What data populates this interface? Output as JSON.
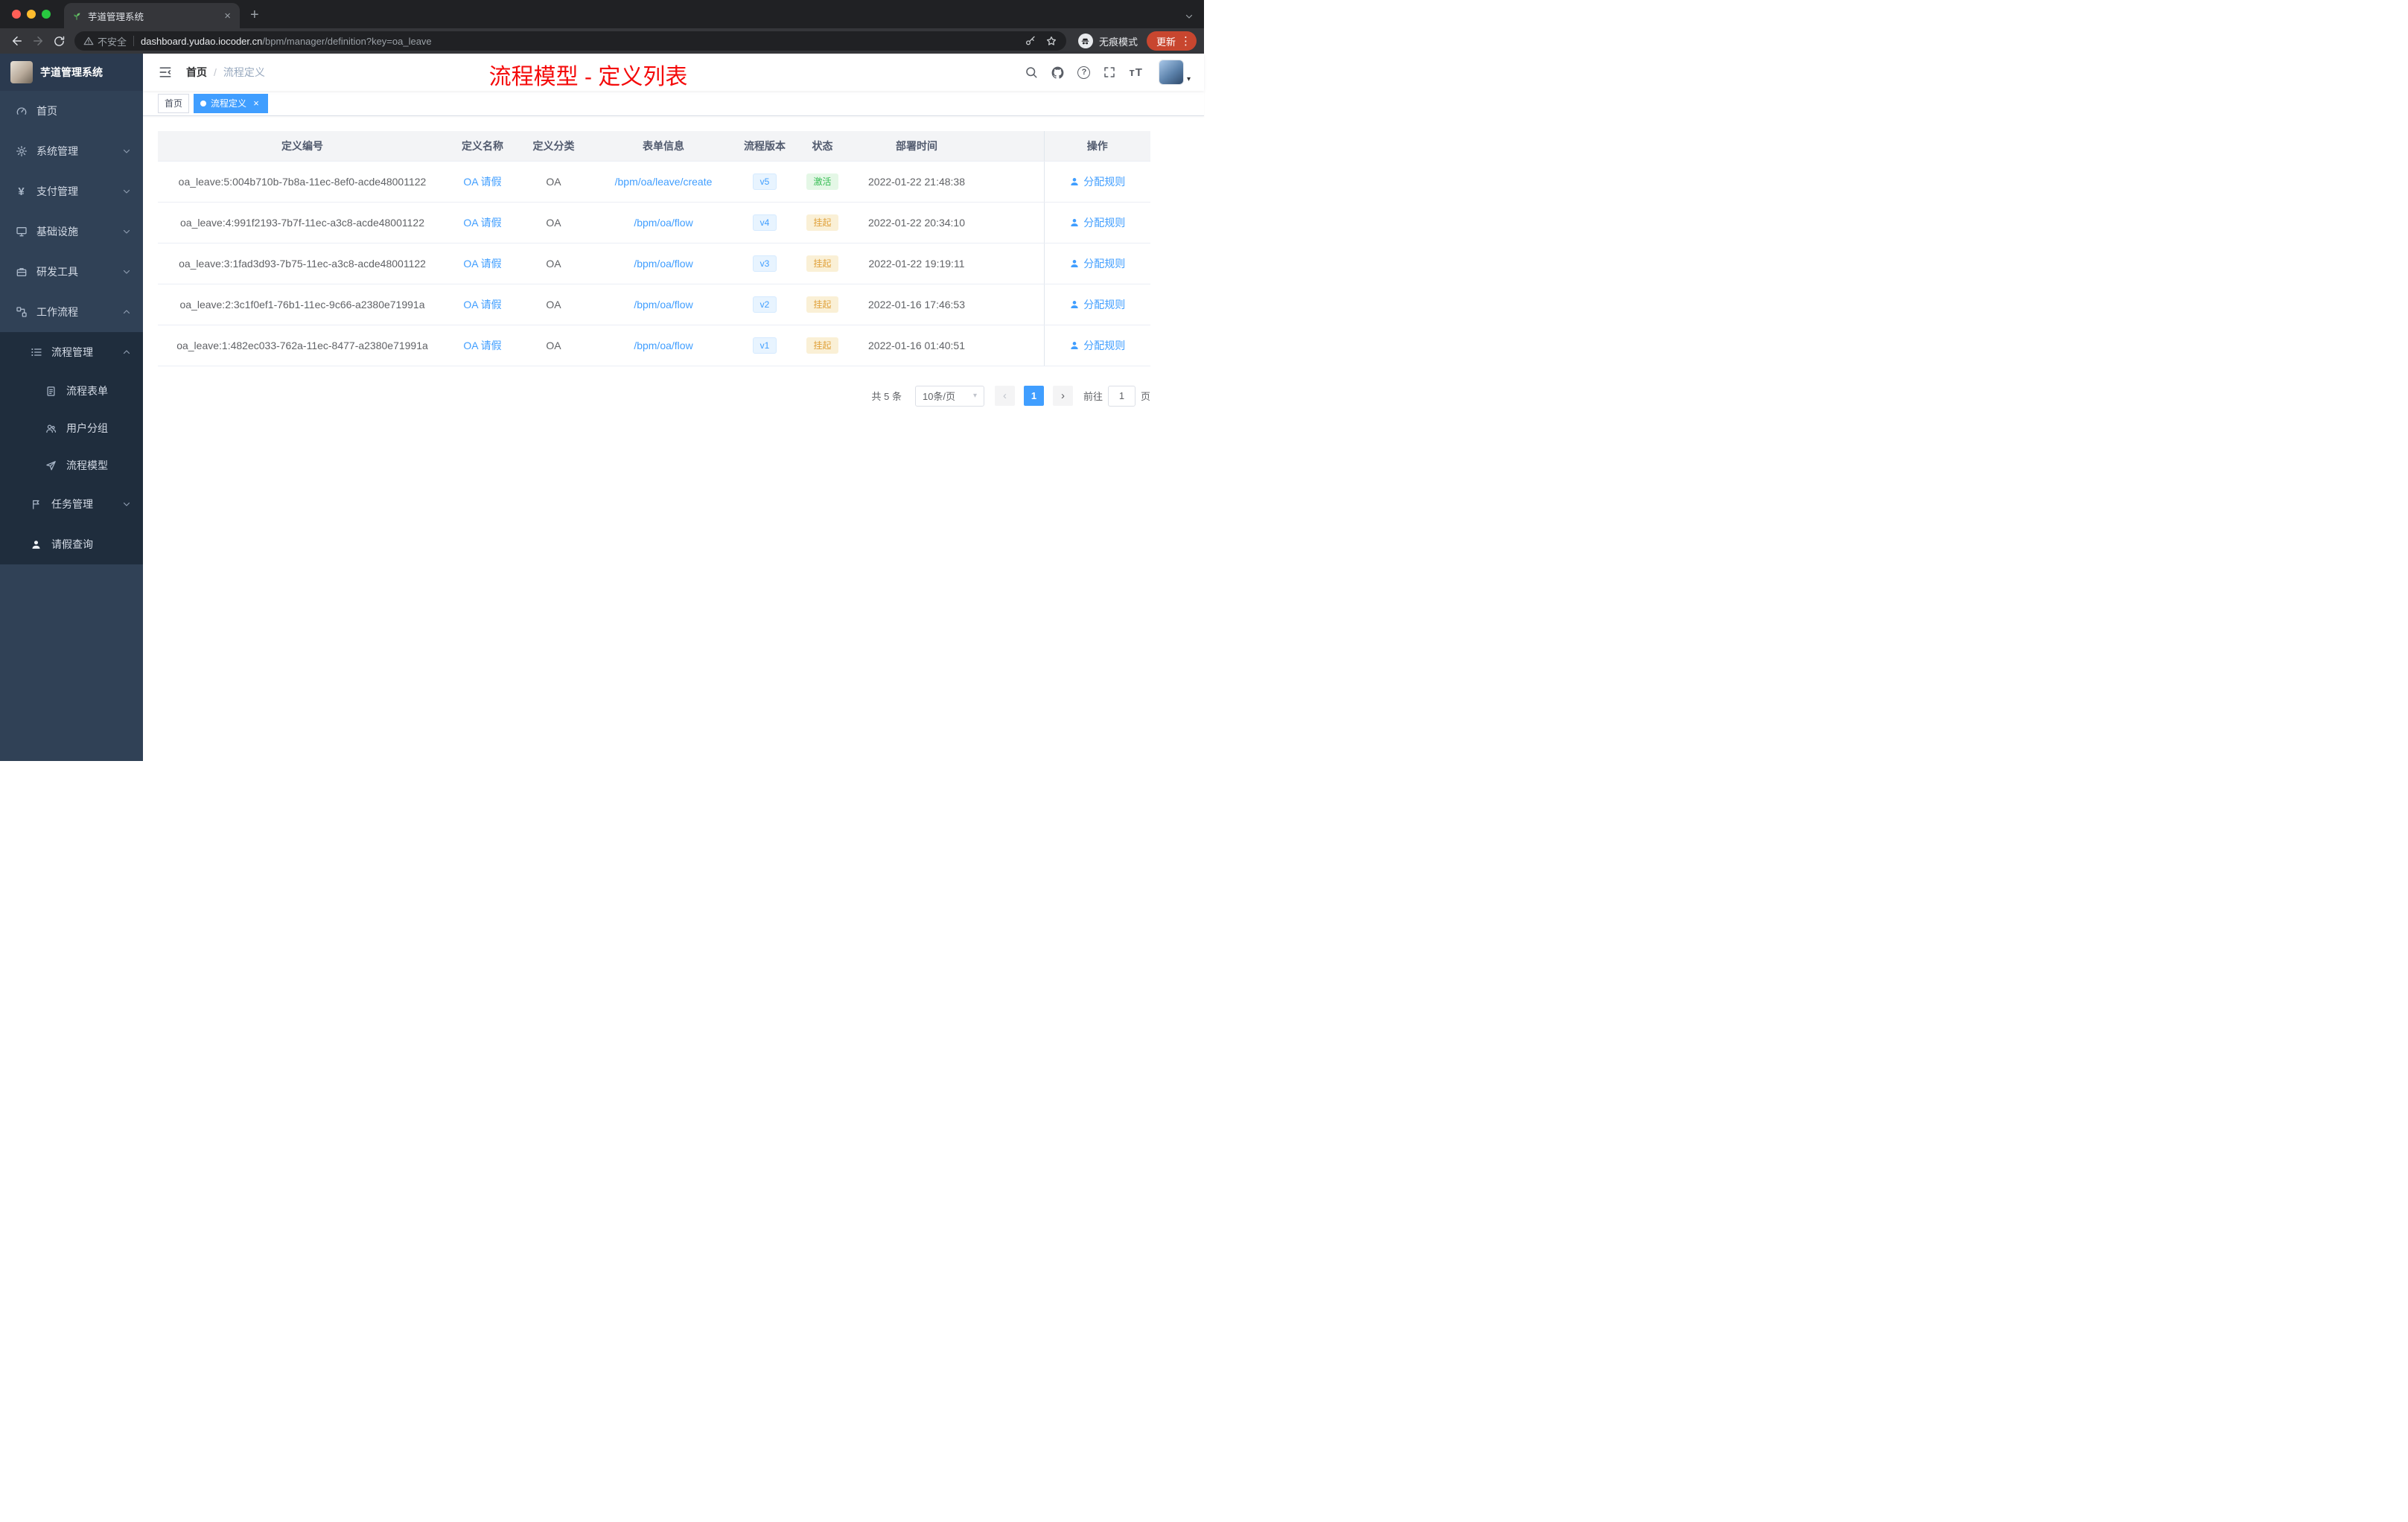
{
  "browser": {
    "tab_title": "芋道管理系统",
    "security": "不安全",
    "host": "dashboard.yudao.iocoder.cn",
    "path": "/bpm/manager/definition?key=oa_leave",
    "incognito": "无痕模式",
    "update": "更新"
  },
  "sidebar": {
    "logo_title": "芋道管理系统",
    "items": [
      {
        "label": "首页"
      },
      {
        "label": "系统管理",
        "expandable": true
      },
      {
        "label": "支付管理",
        "expandable": true
      },
      {
        "label": "基础设施",
        "expandable": true
      },
      {
        "label": "研发工具",
        "expandable": true
      },
      {
        "label": "工作流程",
        "expandable": true,
        "expanded": true,
        "children": [
          {
            "label": "流程管理",
            "expanded": true,
            "children": [
              {
                "label": "流程表单"
              },
              {
                "label": "用户分组"
              },
              {
                "label": "流程模型"
              }
            ]
          },
          {
            "label": "任务管理",
            "expandable": true
          },
          {
            "label": "请假查询"
          }
        ]
      }
    ]
  },
  "header": {
    "breadcrumb_home": "首页",
    "breadcrumb_current": "流程定义",
    "annotation": "流程模型 - 定义列表"
  },
  "tags": [
    {
      "label": "首页",
      "active": false
    },
    {
      "label": "流程定义",
      "active": true
    }
  ],
  "table": {
    "columns": [
      "定义编号",
      "定义名称",
      "定义分类",
      "表单信息",
      "流程版本",
      "状态",
      "部署时间",
      "操作"
    ],
    "action_label": "分配规则",
    "rows": [
      {
        "id": "oa_leave:5:004b710b-7b8a-11ec-8ef0-acde48001122",
        "name": "OA 请假",
        "category": "OA",
        "form": "/bpm/oa/leave/create",
        "version": "v5",
        "status": "激活",
        "status_type": "success",
        "time": "2022-01-22 21:48:38"
      },
      {
        "id": "oa_leave:4:991f2193-7b7f-11ec-a3c8-acde48001122",
        "name": "OA 请假",
        "category": "OA",
        "form": "/bpm/oa/flow",
        "version": "v4",
        "status": "挂起",
        "status_type": "warning",
        "time": "2022-01-22 20:34:10"
      },
      {
        "id": "oa_leave:3:1fad3d93-7b75-11ec-a3c8-acde48001122",
        "name": "OA 请假",
        "category": "OA",
        "form": "/bpm/oa/flow",
        "version": "v3",
        "status": "挂起",
        "status_type": "warning",
        "time": "2022-01-22 19:19:11"
      },
      {
        "id": "oa_leave:2:3c1f0ef1-76b1-11ec-9c66-a2380e71991a",
        "name": "OA 请假",
        "category": "OA",
        "form": "/bpm/oa/flow",
        "version": "v2",
        "status": "挂起",
        "status_type": "warning",
        "time": "2022-01-16 17:46:53"
      },
      {
        "id": "oa_leave:1:482ec033-762a-11ec-8477-a2380e71991a",
        "name": "OA 请假",
        "category": "OA",
        "form": "/bpm/oa/flow",
        "version": "v1",
        "status": "挂起",
        "status_type": "warning",
        "time": "2022-01-16 01:40:51"
      }
    ]
  },
  "pagination": {
    "total_label": "共 5 条",
    "page_size_label": "10条/页",
    "current_page": "1",
    "goto_label": "前往",
    "goto_value": "1",
    "unit_label": "页"
  },
  "glyphs": {
    "close": "×",
    "plus": "+",
    "kebab": "⋮",
    "caret_down": "▾",
    "chevron_left": "‹",
    "chevron_right": "›",
    "yen": "¥",
    "question": "?",
    "slash": "/",
    "font_size": "тT"
  },
  "colors": {
    "accent": "#409eff",
    "success": "#35bd53",
    "warning": "#e0a23c",
    "annotation_red": "#f40a0a",
    "sidebar_bg": "#304156",
    "submenu_bg": "#1f2d3d",
    "update_pill": "#c8462f"
  }
}
